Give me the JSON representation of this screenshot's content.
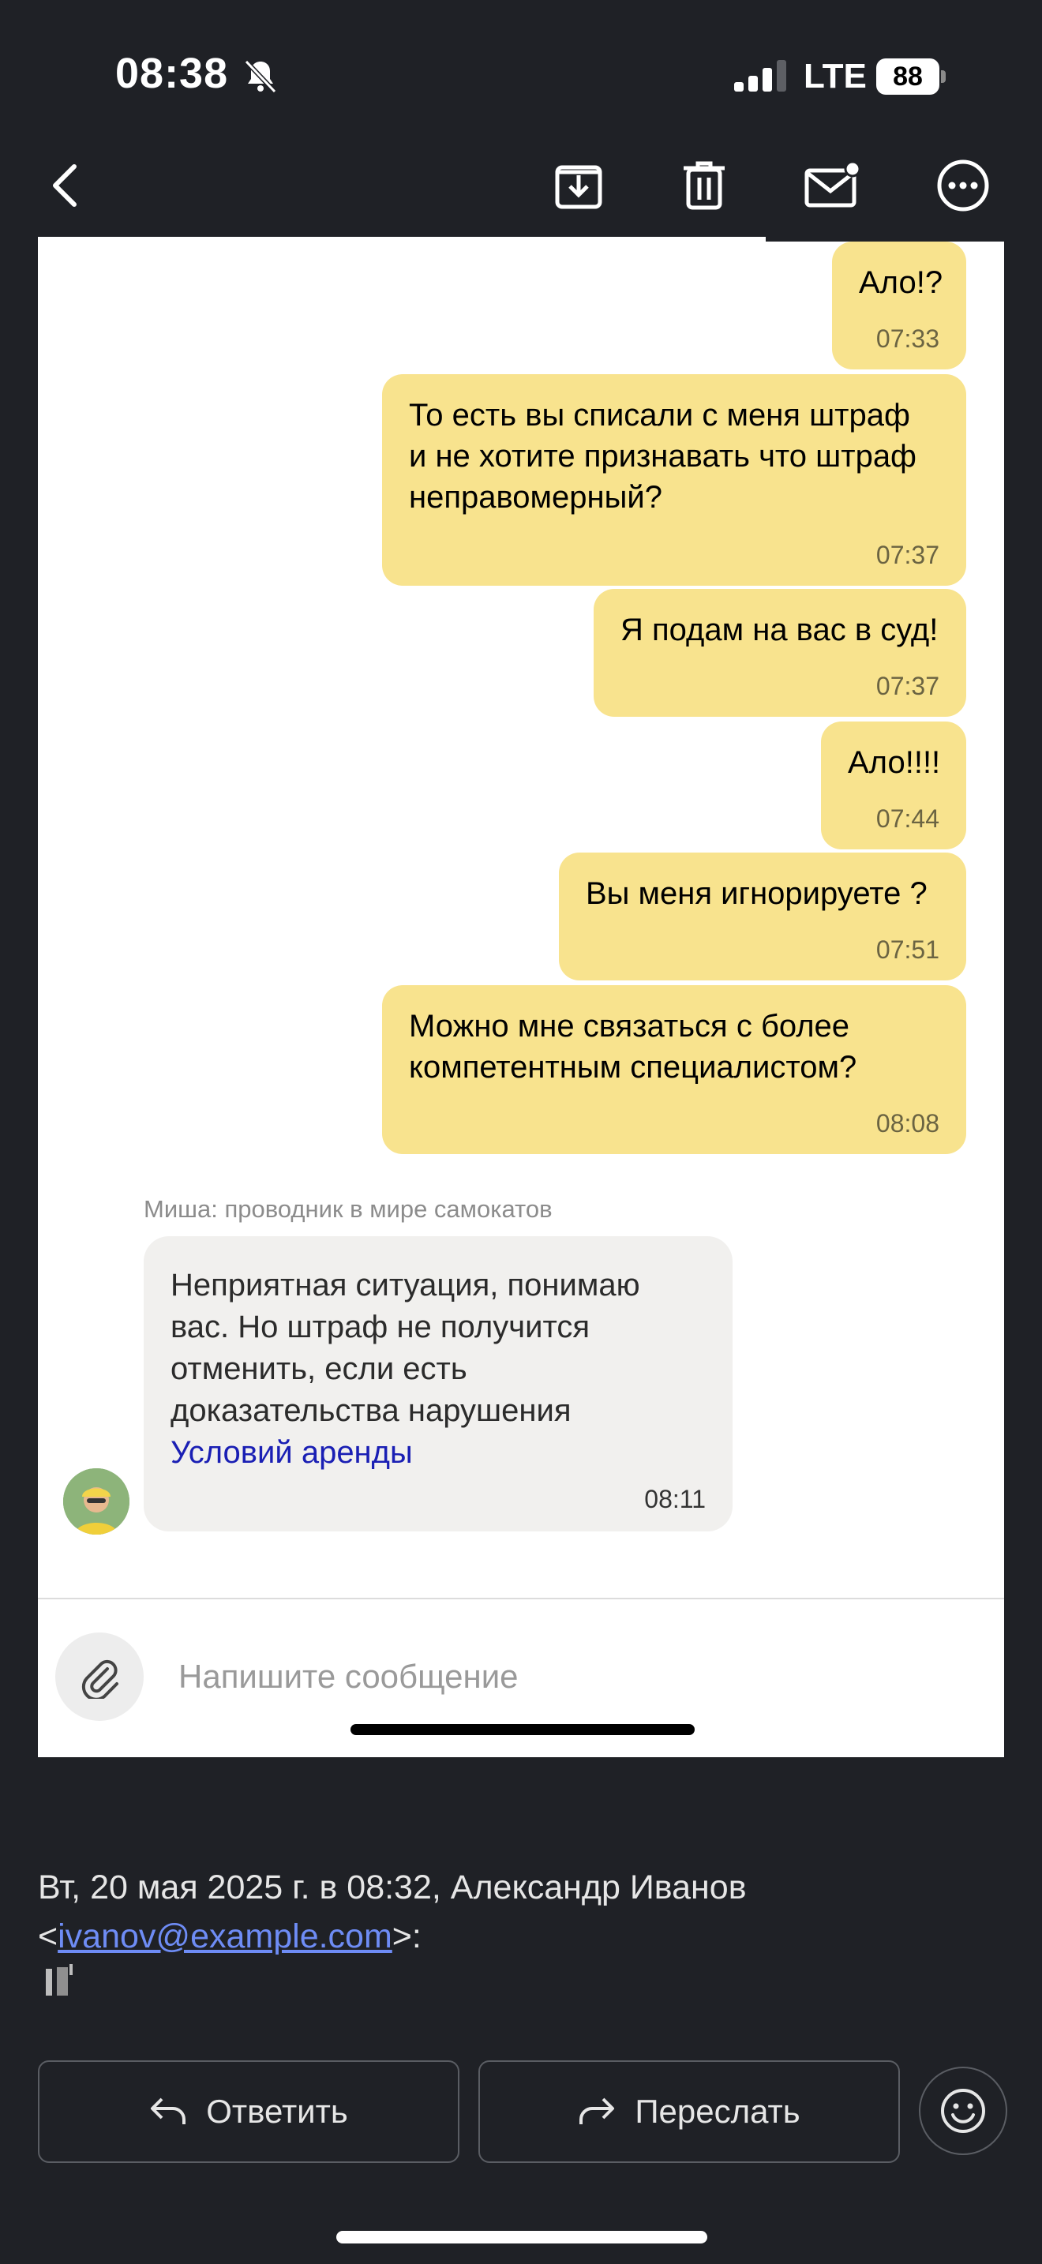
{
  "status_bar": {
    "time": "08:38",
    "network": "LTE",
    "battery": "88"
  },
  "toolbar": {
    "back_icon": "chevron-left-icon",
    "archive_icon": "archive-download-icon",
    "delete_icon": "trash-icon",
    "unread_icon": "mail-unread-icon",
    "more_icon": "more-horizontal-icon"
  },
  "chat": {
    "outgoing": [
      {
        "lines": [
          "Ало!?"
        ],
        "time": "07:33"
      },
      {
        "lines": [
          "То есть вы списали с меня штраф",
          "и не хотите признавать что штраф",
          "неправомерный?"
        ],
        "time": "07:37"
      },
      {
        "lines": [
          "Я подам на вас в суд!"
        ],
        "time": "07:37"
      },
      {
        "lines": [
          "Ало!!!!"
        ],
        "time": "07:44"
      },
      {
        "lines": [
          "Вы меня игнорируете ?"
        ],
        "time": "07:51"
      },
      {
        "lines": [
          "Можно мне связаться с более",
          "компетентным специалистом?"
        ],
        "time": "08:08"
      }
    ],
    "incoming": {
      "sender": "Миша: проводник в мире самокатов",
      "lines": [
        "Неприятная ситуация, понимаю",
        "вас. Но штраф не получится",
        "отменить, если есть",
        "доказательства нарушения"
      ],
      "link": "Условий аренды",
      "time": "08:11"
    },
    "input_placeholder": "Напишите сообщение"
  },
  "mail": {
    "header": "Вт, 20 мая 2025 г. в 08:32, Александр Иванов",
    "email_prefix": "<",
    "email": "ivanov@example.com",
    "email_suffix": ">:"
  },
  "actions": {
    "reply_label": "Ответить",
    "forward_label": "Переслать"
  },
  "colors": {
    "outgoing_bubble": "#f8e38e",
    "incoming_bubble": "#f1f0ee",
    "link": "#1a1fb4",
    "background": "#1f2126"
  }
}
